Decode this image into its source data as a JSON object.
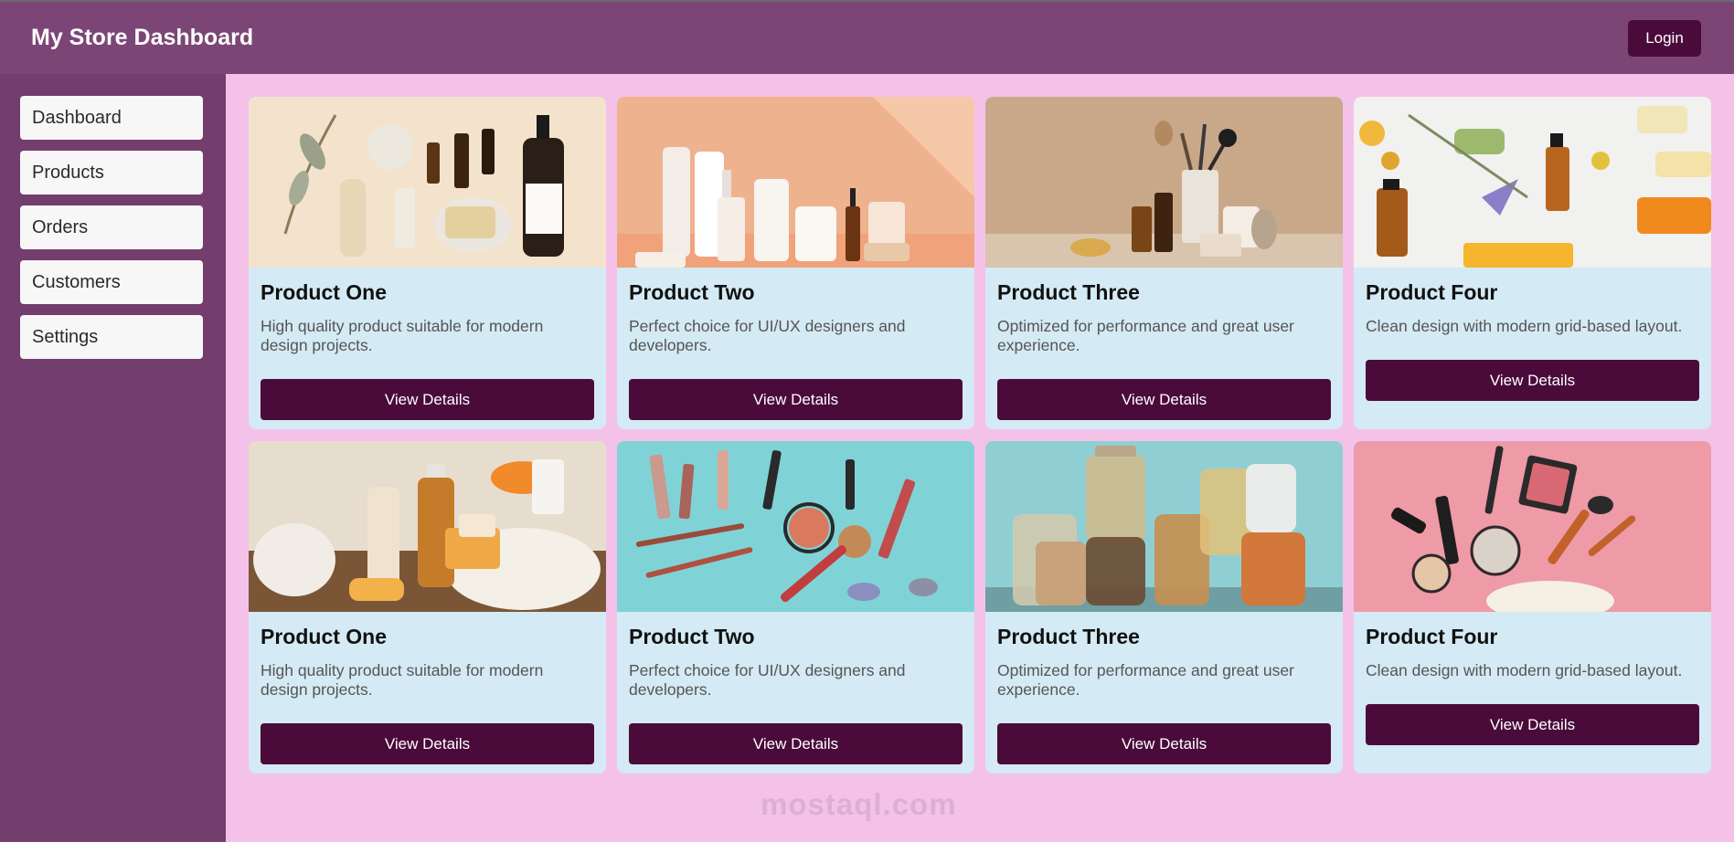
{
  "header": {
    "title": "My Store Dashboard",
    "login_label": "Login"
  },
  "sidebar": {
    "items": [
      {
        "label": "Dashboard"
      },
      {
        "label": "Products"
      },
      {
        "label": "Orders"
      },
      {
        "label": "Customers"
      },
      {
        "label": "Settings"
      }
    ]
  },
  "products": [
    {
      "title": "Product One",
      "description": "High quality product suitable for modern design projects.",
      "button_label": "View Details"
    },
    {
      "title": "Product Two",
      "description": "Perfect choice for UI/UX designers and developers.",
      "button_label": "View Details"
    },
    {
      "title": "Product Three",
      "description": "Optimized for performance and great user experience.",
      "button_label": "View Details"
    },
    {
      "title": "Product Four",
      "description": "Clean design with modern grid-based layout.",
      "button_label": "View Details"
    },
    {
      "title": "Product One",
      "description": "High quality product suitable for modern design projects.",
      "button_label": "View Details"
    },
    {
      "title": "Product Two",
      "description": "Perfect choice for UI/UX designers and developers.",
      "button_label": "View Details"
    },
    {
      "title": "Product Three",
      "description": "Optimized for performance and great user experience.",
      "button_label": "View Details"
    },
    {
      "title": "Product Four",
      "description": "Clean design with modern grid-based layout.",
      "button_label": "View Details"
    }
  ],
  "watermark": "mostaql.com",
  "colors": {
    "header_bg": "#7b4676",
    "sidebar_bg": "#733d6e",
    "page_bg": "#f4c2e8",
    "card_bg": "#d4eaf4",
    "button_bg": "#4a0b3b"
  }
}
